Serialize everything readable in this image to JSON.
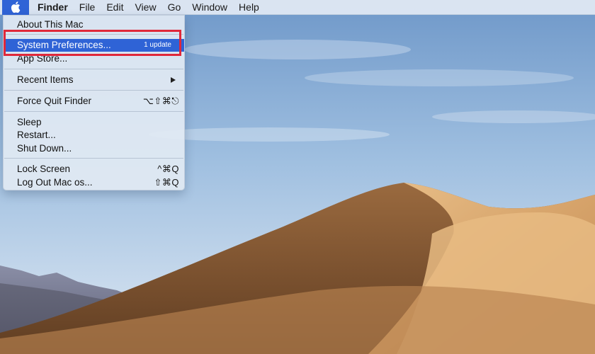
{
  "menubar": {
    "apple_icon": "apple-logo-icon",
    "items": [
      "Finder",
      "File",
      "Edit",
      "View",
      "Go",
      "Window",
      "Help"
    ]
  },
  "apple_menu": {
    "about": "About This Mac",
    "system_prefs": {
      "label": "System Preferences...",
      "badge": "1 update"
    },
    "app_store": "App Store...",
    "recent_items": "Recent Items",
    "force_quit": {
      "label": "Force Quit Finder",
      "shortcut": "⌥⇧⌘⎋"
    },
    "sleep": "Sleep",
    "restart": "Restart...",
    "shutdown": "Shut Down...",
    "lock": {
      "label": "Lock Screen",
      "shortcut": "^⌘Q"
    },
    "logout": {
      "label": "Log Out Mac os...",
      "shortcut": "⇧⌘Q"
    }
  },
  "colors": {
    "selection": "#2f63d6",
    "annotation_box": "#e0283a",
    "sky": "#7fa8d4",
    "dune": "#c8955c"
  }
}
